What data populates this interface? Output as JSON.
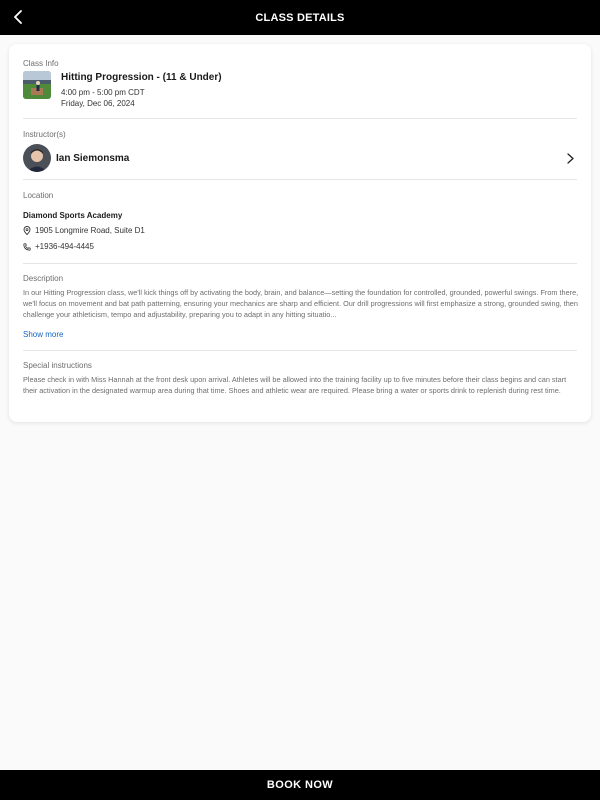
{
  "header": {
    "title": "CLASS DETAILS",
    "back_icon": "chevron-left-icon"
  },
  "class_info": {
    "label": "Class Info",
    "title": "Hitting Progression - (11 & Under)",
    "time": "4:00 pm - 5:00 pm CDT",
    "date": "Friday, Dec 06, 2024"
  },
  "instructor": {
    "label": "Instructor(s)",
    "name": "Ian Siemonsma"
  },
  "location": {
    "label": "Location",
    "name": "Diamond Sports Academy",
    "address": "1905 Longmire Road, Suite D1",
    "phone": "+1936-494-4445"
  },
  "description": {
    "label": "Description",
    "text": "In our Hitting Progression class, we'll kick things off by activating the body, brain, and balance—setting the foundation for controlled, grounded, powerful swings. From there, we'll focus on movement and bat path patterning, ensuring your mechanics are sharp and efficient. Our drill progressions will first emphasize a strong, grounded swing, then challenge your athleticism, tempo and adjustability, preparing you to adapt in any hitting situatio...",
    "show_more": "Show more"
  },
  "special_instructions": {
    "label": "Special instructions",
    "text": "Please check in with Miss Hannah at the front desk upon arrival. Athletes will be allowed into the training facility up to five minutes before their class begins and can start their activation in the designated warmup area during that time. Shoes and athletic wear are required. Please bring a water or sports drink to replenish during rest time."
  },
  "footer": {
    "book_label": "BOOK NOW"
  },
  "colors": {
    "bar_bg": "#000000",
    "link": "#1565c0",
    "muted_text": "#6d6d6d"
  }
}
